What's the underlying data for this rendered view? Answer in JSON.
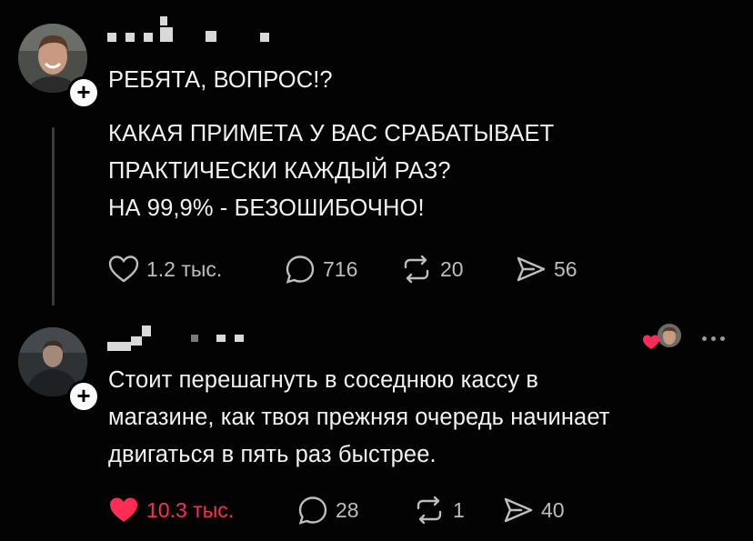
{
  "post": {
    "title": "РЕБЯТА, ВОПРОС!?",
    "body_lines": [
      "КАКАЯ ПРИМЕТА У ВАС СРАБАТЫВАЕТ",
      "ПРАКТИЧЕСКИ КАЖДЫЙ РАЗ?",
      "НА 99,9% - БЕЗОШИБОЧНО!"
    ],
    "likes": "1.2 тыс.",
    "comments": "716",
    "reposts": "20",
    "shares": "56"
  },
  "reply": {
    "body_lines": [
      "Стоит перешагнуть в соседнюю кассу в",
      "магазине, как твоя прежняя очередь начинает",
      "двигаться в пять раз быстрее."
    ],
    "likes": "10.3 тыс.",
    "comments": "28",
    "reposts": "1",
    "shares": "40"
  },
  "icons": {
    "like": "heart-icon",
    "comment": "comment-bubble-icon",
    "repost": "repost-arrows-icon",
    "share": "send-icon",
    "follow": "plus-icon",
    "more": "more-dots-icon"
  },
  "colors": {
    "background": "#030303",
    "text": "#f2f2f2",
    "muted": "#bdbdbd",
    "like_active": "#ff2d55"
  }
}
